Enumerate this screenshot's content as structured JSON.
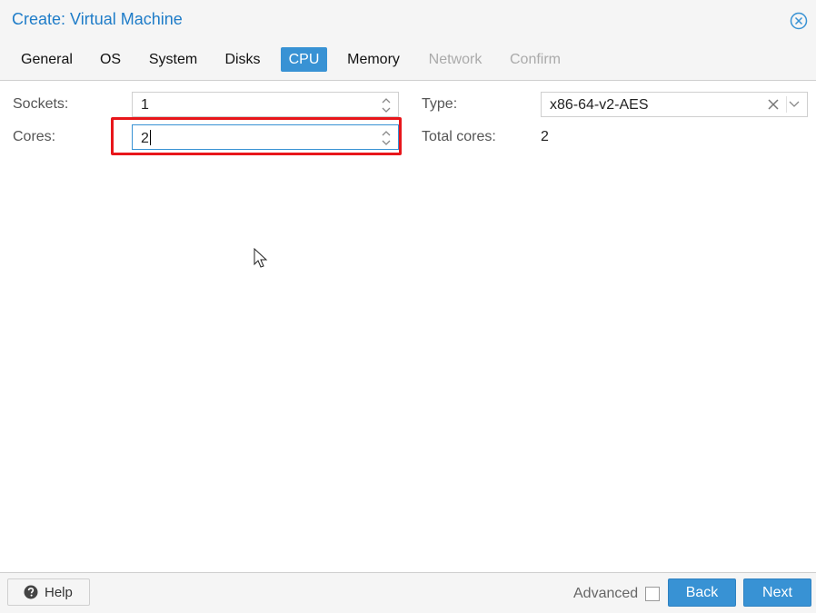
{
  "window": {
    "title": "Create: Virtual Machine",
    "close_icon": "close-circle-icon"
  },
  "tabs": [
    {
      "label": "General",
      "state": "normal"
    },
    {
      "label": "OS",
      "state": "normal"
    },
    {
      "label": "System",
      "state": "normal"
    },
    {
      "label": "Disks",
      "state": "normal"
    },
    {
      "label": "CPU",
      "state": "active"
    },
    {
      "label": "Memory",
      "state": "normal"
    },
    {
      "label": "Network",
      "state": "disabled"
    },
    {
      "label": "Confirm",
      "state": "disabled"
    }
  ],
  "form": {
    "sockets": {
      "label": "Sockets:",
      "value": "1"
    },
    "cores": {
      "label": "Cores:",
      "value": "2"
    },
    "type": {
      "label": "Type:",
      "value": "x86-64-v2-AES"
    },
    "total_cores": {
      "label": "Total cores:",
      "value": "2"
    }
  },
  "footer": {
    "help_label": "Help",
    "advanced_label": "Advanced",
    "advanced_checked": false,
    "back_label": "Back",
    "next_label": "Next"
  },
  "colors": {
    "accent": "#3892d4",
    "title": "#1e7cc8",
    "highlight": "#e8161b"
  }
}
